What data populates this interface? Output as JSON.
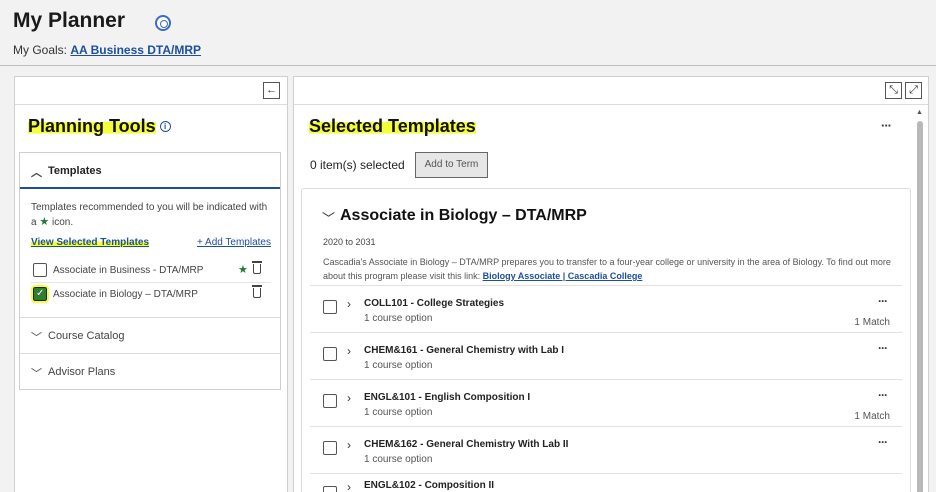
{
  "header": {
    "title": "My Planner",
    "goals_label": "My Goals:",
    "goals_link": "AA Business DTA/MRP"
  },
  "left_panel": {
    "collapse_icon": "arrow-left-icon",
    "heading": "Planning Tools",
    "templates_section": {
      "label": "Templates",
      "hint_pre": "Templates recommended to you will be indicated with a",
      "hint_post": "icon.",
      "view_selected": "View Selected Templates",
      "add_templates": "+ Add Templates",
      "items": [
        {
          "name": "Associate in Business - DTA/MRP",
          "checked": false,
          "recommended": true
        },
        {
          "name": "Associate in Biology – DTA/MRP",
          "checked": true,
          "recommended": false
        }
      ]
    },
    "other_sections": [
      "Course Catalog",
      "Advisor Plans"
    ]
  },
  "right_panel": {
    "heading": "Selected Templates",
    "selected_count": "0 item(s) selected",
    "add_to_term": "Add to Term",
    "more": "···",
    "template": {
      "title": "Associate in Biology – DTA/MRP",
      "years": "2020 to 2031",
      "description": "Cascadia's Associate in Biology – DTA/MRP prepares you to transfer to a four-year college or university in the area of Biology. To find out more about this program please visit this link:",
      "link_text": "Biology Associate | Cascadia College",
      "courses": [
        {
          "code": "COLL101 - College Strategies",
          "options": "1 course option",
          "match": "1 Match"
        },
        {
          "code": "CHEM&161 - General Chemistry with Lab I",
          "options": "1 course option",
          "match": ""
        },
        {
          "code": "ENGL&101 - English Composition I",
          "options": "1 course option",
          "match": "1 Match"
        },
        {
          "code": "CHEM&162 - General Chemistry With Lab II",
          "options": "1 course option",
          "match": ""
        },
        {
          "code": "ENGL&102 - Composition II",
          "options": "",
          "match": ""
        }
      ]
    }
  },
  "colors": {
    "link": "#1d4fa0",
    "highlight": "#f4ff3a",
    "star": "#1f7a33"
  }
}
